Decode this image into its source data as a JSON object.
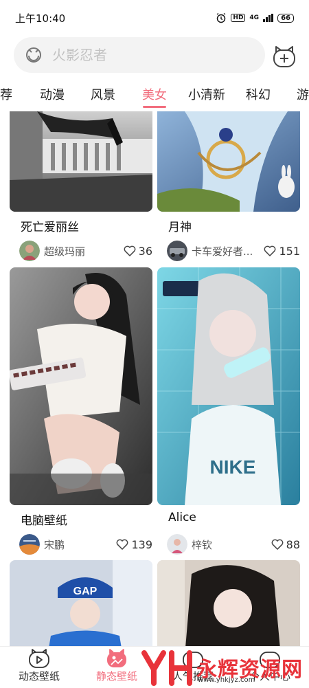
{
  "status_bar": {
    "time": "上午10:40",
    "hd": "HD",
    "network": "4G",
    "battery": "66"
  },
  "search": {
    "placeholder": "火影忍者"
  },
  "tabs": [
    {
      "label": "荐"
    },
    {
      "label": "动漫"
    },
    {
      "label": "风景"
    },
    {
      "label": "美女"
    },
    {
      "label": "小清新"
    },
    {
      "label": "科幻"
    },
    {
      "label": "游"
    }
  ],
  "active_tab": "美女",
  "cards": [
    {
      "title": "死亡爱丽丝",
      "author": "超级玛丽",
      "likes": "36"
    },
    {
      "title": "月神",
      "author": "卡车爱好者...",
      "likes": "151"
    },
    {
      "title": "电脑壁纸",
      "author": "宋鹏",
      "likes": "139"
    },
    {
      "title": "Alice",
      "author": "梓钦",
      "likes": "88"
    },
    {
      "title": "",
      "author": "",
      "likes": ""
    },
    {
      "title": "",
      "author": "",
      "likes": ""
    }
  ],
  "bottom_nav": [
    {
      "label": "动态壁纸",
      "icon": "play-icon"
    },
    {
      "label": "静态壁纸",
      "icon": "image-icon"
    },
    {
      "label": "人气推荐",
      "icon": "fire-icon"
    },
    {
      "label": "个人中心",
      "icon": "user-icon"
    }
  ],
  "watermark": {
    "text": "永辉资源网",
    "url": "www.yhkjyz.com"
  },
  "colors": {
    "accent": "#f26d7d",
    "watermark": "#e8333a"
  }
}
